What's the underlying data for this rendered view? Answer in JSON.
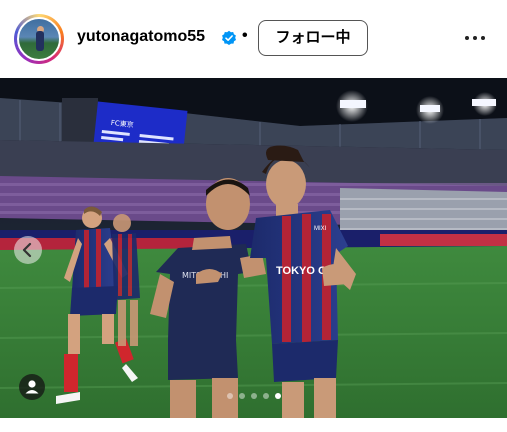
{
  "post_header": {
    "username": "yutonagatomo55",
    "separator": "•",
    "follow_button_label": "フォロー中",
    "verified_icon": "verified-badge-icon",
    "more_icon": "more-options-icon",
    "verified_color": "#0095f6"
  },
  "media": {
    "scoreboard_text": "FC東京",
    "sponsor_text_left": "MITSUBISHI",
    "sponsor_text_right": "TOKYO GAS",
    "chest_badge_right": "MIXI",
    "carousel": {
      "total_slides": 5,
      "active_index": 4
    },
    "prev_icon": "chevron-left-icon",
    "tag_icon": "user-tag-icon"
  }
}
